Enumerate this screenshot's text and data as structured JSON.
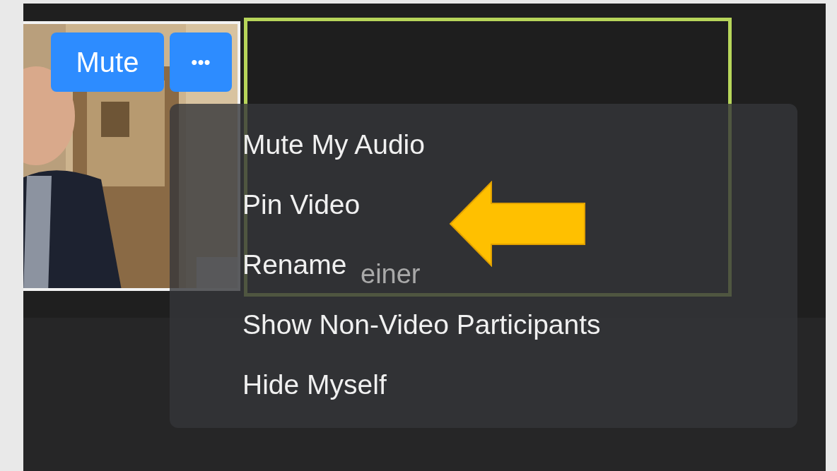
{
  "video_tiles": [
    {
      "kind": "picture",
      "buttons": [
        "Mute",
        "•••"
      ]
    },
    {
      "kind": "speaker",
      "active_speaker": true,
      "name": "einer"
    }
  ],
  "context_menu": {
    "items": [
      "Mute My Audio",
      "Pin Video",
      "Rename",
      "Show Non-Video Participants",
      "Hide Myself"
    ]
  }
}
